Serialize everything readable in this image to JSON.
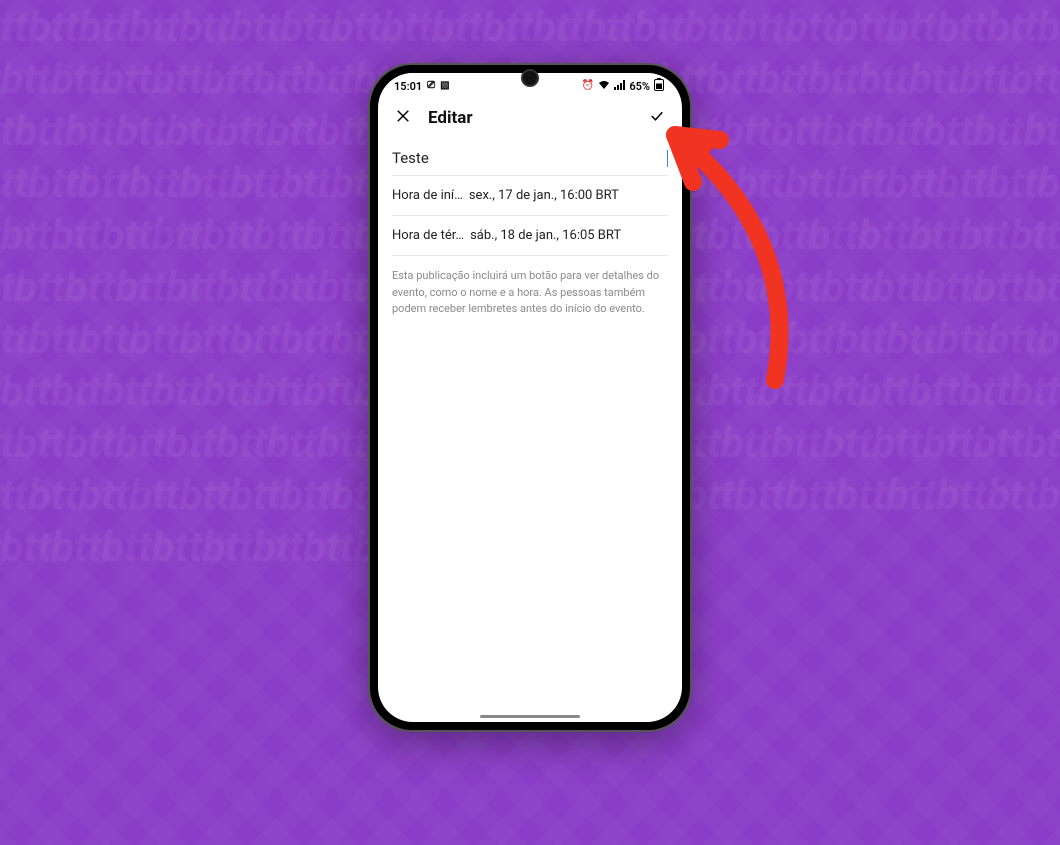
{
  "status_bar": {
    "time": "15:01",
    "battery_pct": "65%"
  },
  "header": {
    "title": "Editar"
  },
  "event": {
    "title_value": "Teste",
    "start_label": "Hora de iní…",
    "start_value": "sex., 17 de jan., 16:00 BRT",
    "end_label": "Hora de tér…",
    "end_value": "sáb., 18 de jan., 16:05 BRT",
    "info_text": "Esta publicação incluirá um botão para ver detalhes do evento, como o nome e a hora. As pessoas também podem receber lembretes antes do início do evento."
  },
  "colors": {
    "background": "#8b3dc7",
    "arrow": "#f13322"
  }
}
